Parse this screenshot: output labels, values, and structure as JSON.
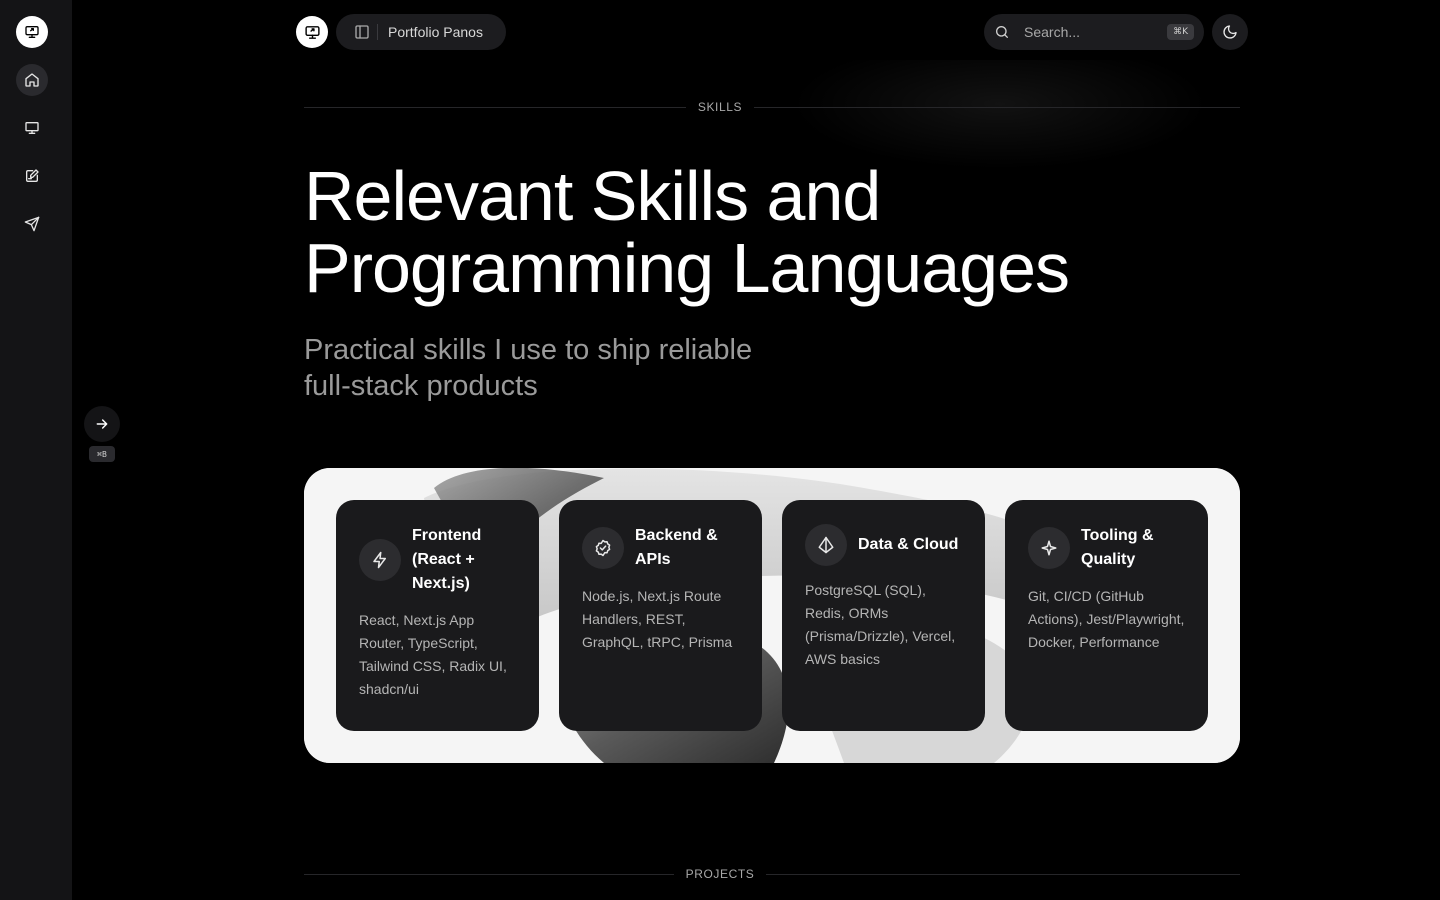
{
  "header": {
    "site_name": "Portfolio Panos",
    "search_placeholder": "Search...",
    "search_shortcut": "⌘K"
  },
  "sidebar": {
    "items": [
      {
        "icon": "monitor-logo-icon"
      },
      {
        "icon": "home-icon",
        "active": true
      },
      {
        "icon": "presentation-icon"
      },
      {
        "icon": "edit-notes-icon"
      },
      {
        "icon": "send-icon"
      }
    ],
    "toggle_shortcut": "⌘B"
  },
  "skills": {
    "section_label": "SKILLS",
    "title_line1": "Relevant Skills and",
    "title_line2": "Programming Languages",
    "subtitle_line1": "Practical skills I use to ship reliable",
    "subtitle_line2": "full-stack products",
    "cards": [
      {
        "icon": "lightning-icon",
        "title": "Frontend (React + Next.js)",
        "description": "React, Next.js App Router, TypeScript, Tailwind CSS, Radix UI, shadcn/ui"
      },
      {
        "icon": "badge-check-icon",
        "title": "Backend & APIs",
        "description": "Node.js, Next.js Route Handlers, REST, GraphQL, tRPC, Prisma"
      },
      {
        "icon": "prism-icon",
        "title": "Data & Cloud",
        "description": "PostgreSQL (SQL), Redis, ORMs (Prisma/Drizzle), Vercel, AWS basics"
      },
      {
        "icon": "sparkle-icon",
        "title": "Tooling & Quality",
        "description": "Git, CI/CD (GitHub Actions), Jest/Playwright, Docker, Performance"
      }
    ]
  },
  "projects": {
    "section_label": "PROJECTS"
  },
  "colors": {
    "background": "#000000",
    "rail": "#141416",
    "card": "#1a1a1c",
    "muted_text": "#9a9a9a"
  }
}
